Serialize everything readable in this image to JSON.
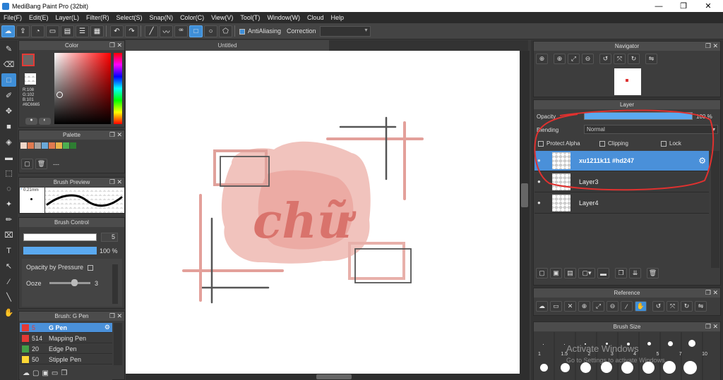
{
  "window": {
    "title": "MediBang Paint Pro (32bit)",
    "minimize": "—",
    "maximize": "❐",
    "close": "✕"
  },
  "menu": [
    "File(F)",
    "Edit(E)",
    "Layer(L)",
    "Filter(R)",
    "Select(S)",
    "Snap(N)",
    "Color(C)",
    "View(V)",
    "Tool(T)",
    "Window(W)",
    "Cloud",
    "Help"
  ],
  "toolbar": {
    "antialiasing": "AntiAliasing",
    "correction": "Correction"
  },
  "color_panel": {
    "title": "Color",
    "readout": [
      "R:108",
      "G:102",
      "B:101",
      "#6C6665"
    ]
  },
  "palette": {
    "title": "Palette",
    "swatches": [
      "#f0d6c8",
      "#e07a4f",
      "#a8a29e",
      "#6aa8d8",
      "#e07a4f",
      "#e8b24a",
      "#4caf50",
      "#2e7d32"
    ],
    "more": "---"
  },
  "brush_preview": {
    "title": "Brush Preview",
    "size": "0.21mm"
  },
  "brush_control": {
    "title": "Brush Control",
    "size_value": "5",
    "opacity_value": "100 %",
    "opacity_by_pressure": "Opacity by Pressure",
    "ooze_label": "Ooze",
    "ooze_value": "3"
  },
  "brush_panel": {
    "title": "Brush: G Pen",
    "items": [
      {
        "size": "5",
        "name": "G Pen",
        "color": "#e53935"
      },
      {
        "size": "514",
        "name": "Mapping Pen",
        "color": "#e53935"
      },
      {
        "size": "20",
        "name": "Edge Pen",
        "color": "#43a047"
      },
      {
        "size": "50",
        "name": "Stipple Pen",
        "color": "#fdd835"
      }
    ]
  },
  "canvas": {
    "tab": "Untitled",
    "text": "chữ"
  },
  "navigator": {
    "title": "Navigator"
  },
  "layer_panel": {
    "title": "Layer",
    "opacity_label": "Opacity",
    "opacity_value": "100 %",
    "blending_label": "Blending",
    "blending_value": "Normal",
    "protect_alpha": "Protect Alpha",
    "clipping": "Clipping",
    "lock": "Lock",
    "layers": [
      "xu1211k11 #hd247",
      "Layer3",
      "Layer4"
    ]
  },
  "reference": {
    "title": "Reference"
  },
  "brush_size": {
    "title": "Brush Size",
    "labels": [
      "1",
      "1.5",
      "2",
      "3",
      "4",
      "5",
      "7",
      "10"
    ],
    "watermark_title": "Activate Windows",
    "watermark_sub": "Go to Settings to activate Windows."
  },
  "colors": {
    "accent": "#3f8fd8",
    "annotation": "#e0312f"
  }
}
